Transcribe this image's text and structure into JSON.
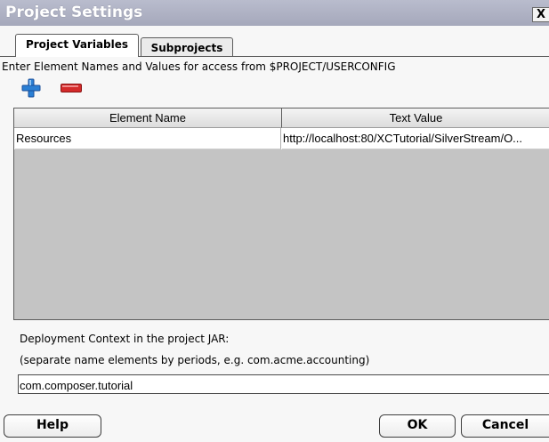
{
  "window": {
    "title": "Project Settings",
    "close_label": "X"
  },
  "tabs": [
    {
      "label": "Project Variables",
      "active": true
    },
    {
      "label": "Subprojects",
      "active": false
    }
  ],
  "instruction": "Enter Element Names and Values for access from $PROJECT/USERCONFIG",
  "toolbar": {
    "add_icon": "plus-icon",
    "remove_icon": "minus-icon",
    "add_color": "#2a7fd4",
    "remove_color": "#d42a2a"
  },
  "table": {
    "columns": [
      "Element Name",
      "Text Value"
    ],
    "rows": [
      [
        "Resources",
        "http://localhost:80/XCTutorial/SilverStream/O..."
      ]
    ]
  },
  "deployment": {
    "label": "Deployment Context in the project JAR:",
    "hint": "(separate name elements by periods, e.g. com.acme.accounting)",
    "value": "com.composer.tutorial"
  },
  "buttons": {
    "help": "Help",
    "ok": "OK",
    "cancel": "Cancel"
  }
}
